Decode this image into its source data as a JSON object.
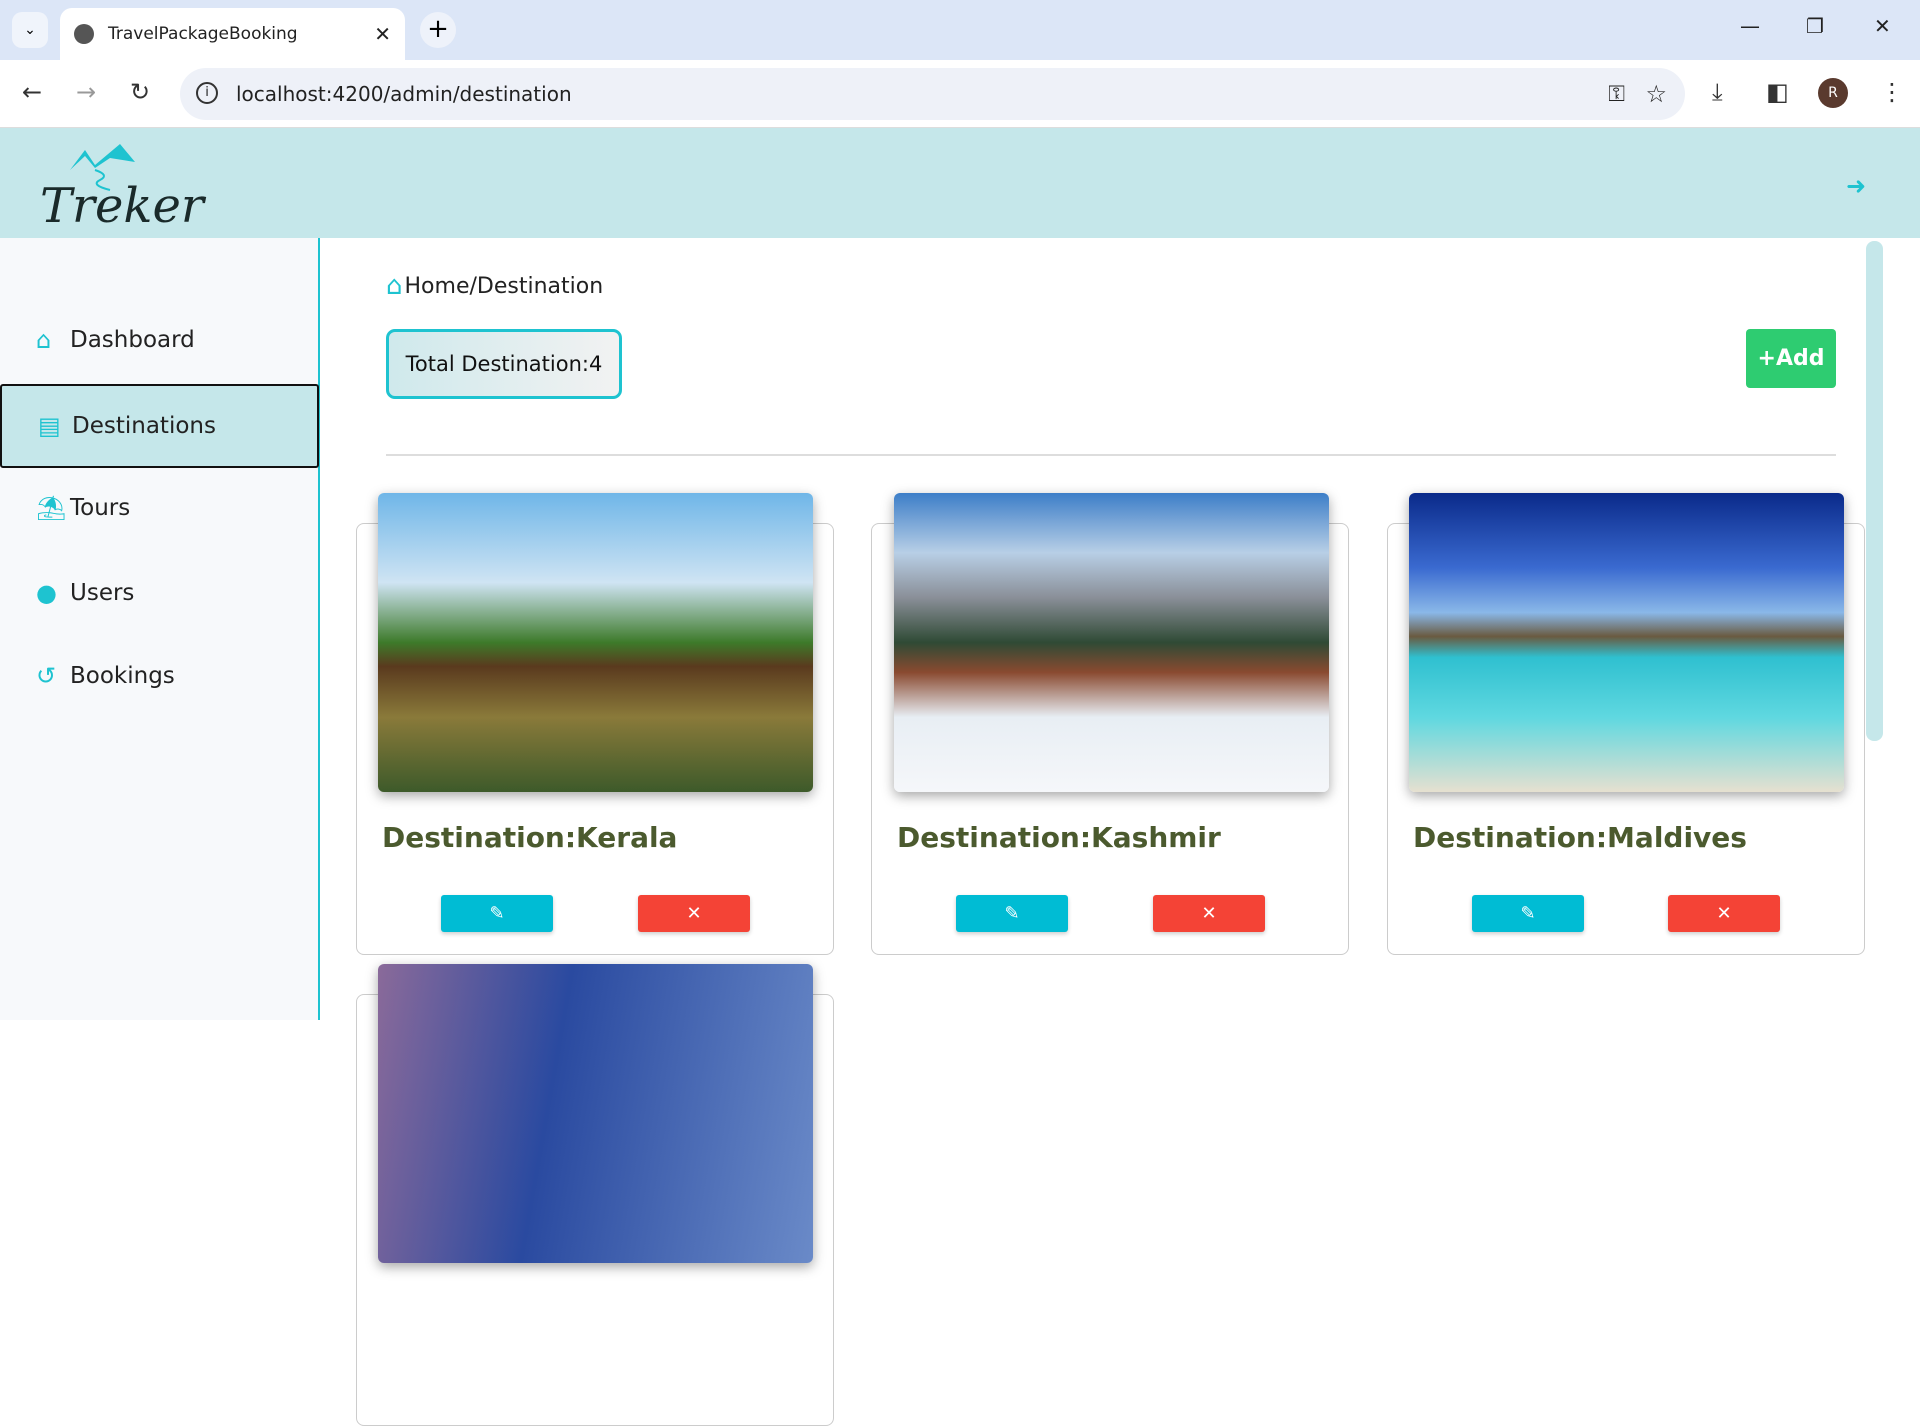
{
  "browser": {
    "tab_title": "TravelPackageBooking",
    "url": "localhost:4200/admin/destination",
    "profile_initial": "R"
  },
  "header": {
    "logo_text": "Treker"
  },
  "sidebar": {
    "items": [
      {
        "label": "Dashboard",
        "icon": "home-icon"
      },
      {
        "label": "Destinations",
        "icon": "book-icon",
        "active": true
      },
      {
        "label": "Tours",
        "icon": "umbrella-beach-icon"
      },
      {
        "label": "Users",
        "icon": "user-icon"
      },
      {
        "label": "Bookings",
        "icon": "history-icon"
      }
    ]
  },
  "main": {
    "breadcrumb": "Home/Destination",
    "total_label": "Total Destination:4",
    "add_label": "+Add",
    "cards": [
      {
        "title": "Destination:Kerala"
      },
      {
        "title": "Destination:Kashmir"
      },
      {
        "title": "Destination:Maldives"
      },
      {
        "title": ""
      }
    ]
  },
  "colors": {
    "accent": "#1ec3d0",
    "header_bg": "#c5e7ea",
    "add": "#2ecc71",
    "edit": "#00bcd4",
    "delete": "#f44336",
    "title": "#4b5a2e"
  }
}
